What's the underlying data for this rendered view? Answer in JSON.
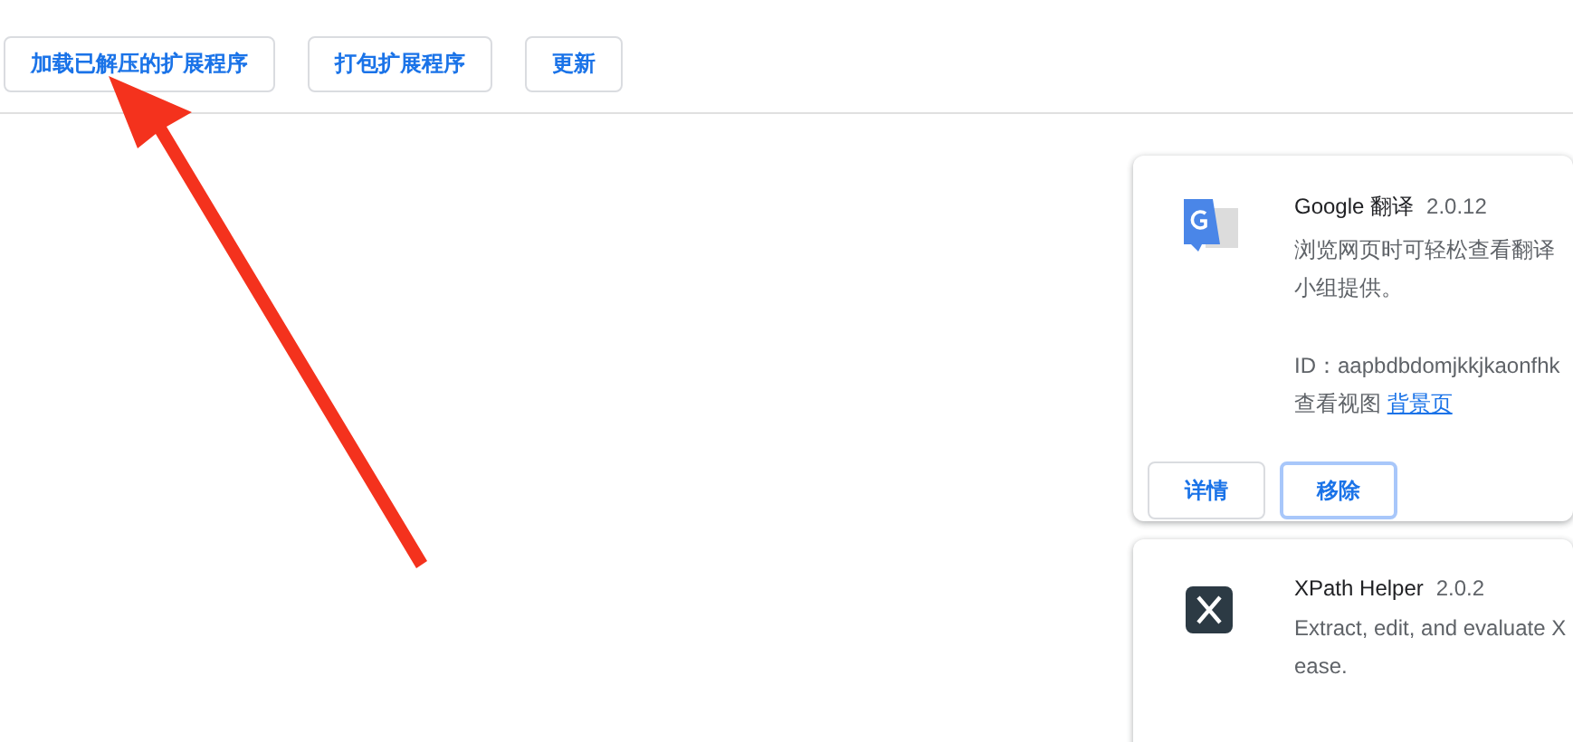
{
  "toolbar": {
    "buttons": [
      {
        "label": "加载已解压的扩展程序"
      },
      {
        "label": "打包扩展程序"
      },
      {
        "label": "更新"
      }
    ]
  },
  "extensions": [
    {
      "name": "Google 翻译",
      "version": "2.0.12",
      "description_lines": [
        "浏览网页时可轻松查看翻译",
        "小组提供。"
      ],
      "id": "ID：aapbdbdomjkkjkaonfhk",
      "views_label": "查看视图",
      "views_link": "背景页",
      "buttons": [
        {
          "label": "详情",
          "focused": false
        },
        {
          "label": "移除",
          "focused": true
        }
      ]
    },
    {
      "name": "XPath Helper",
      "version": "2.0.2",
      "description_lines": [
        "Extract, edit, and evaluate X",
        "ease."
      ]
    }
  ]
}
